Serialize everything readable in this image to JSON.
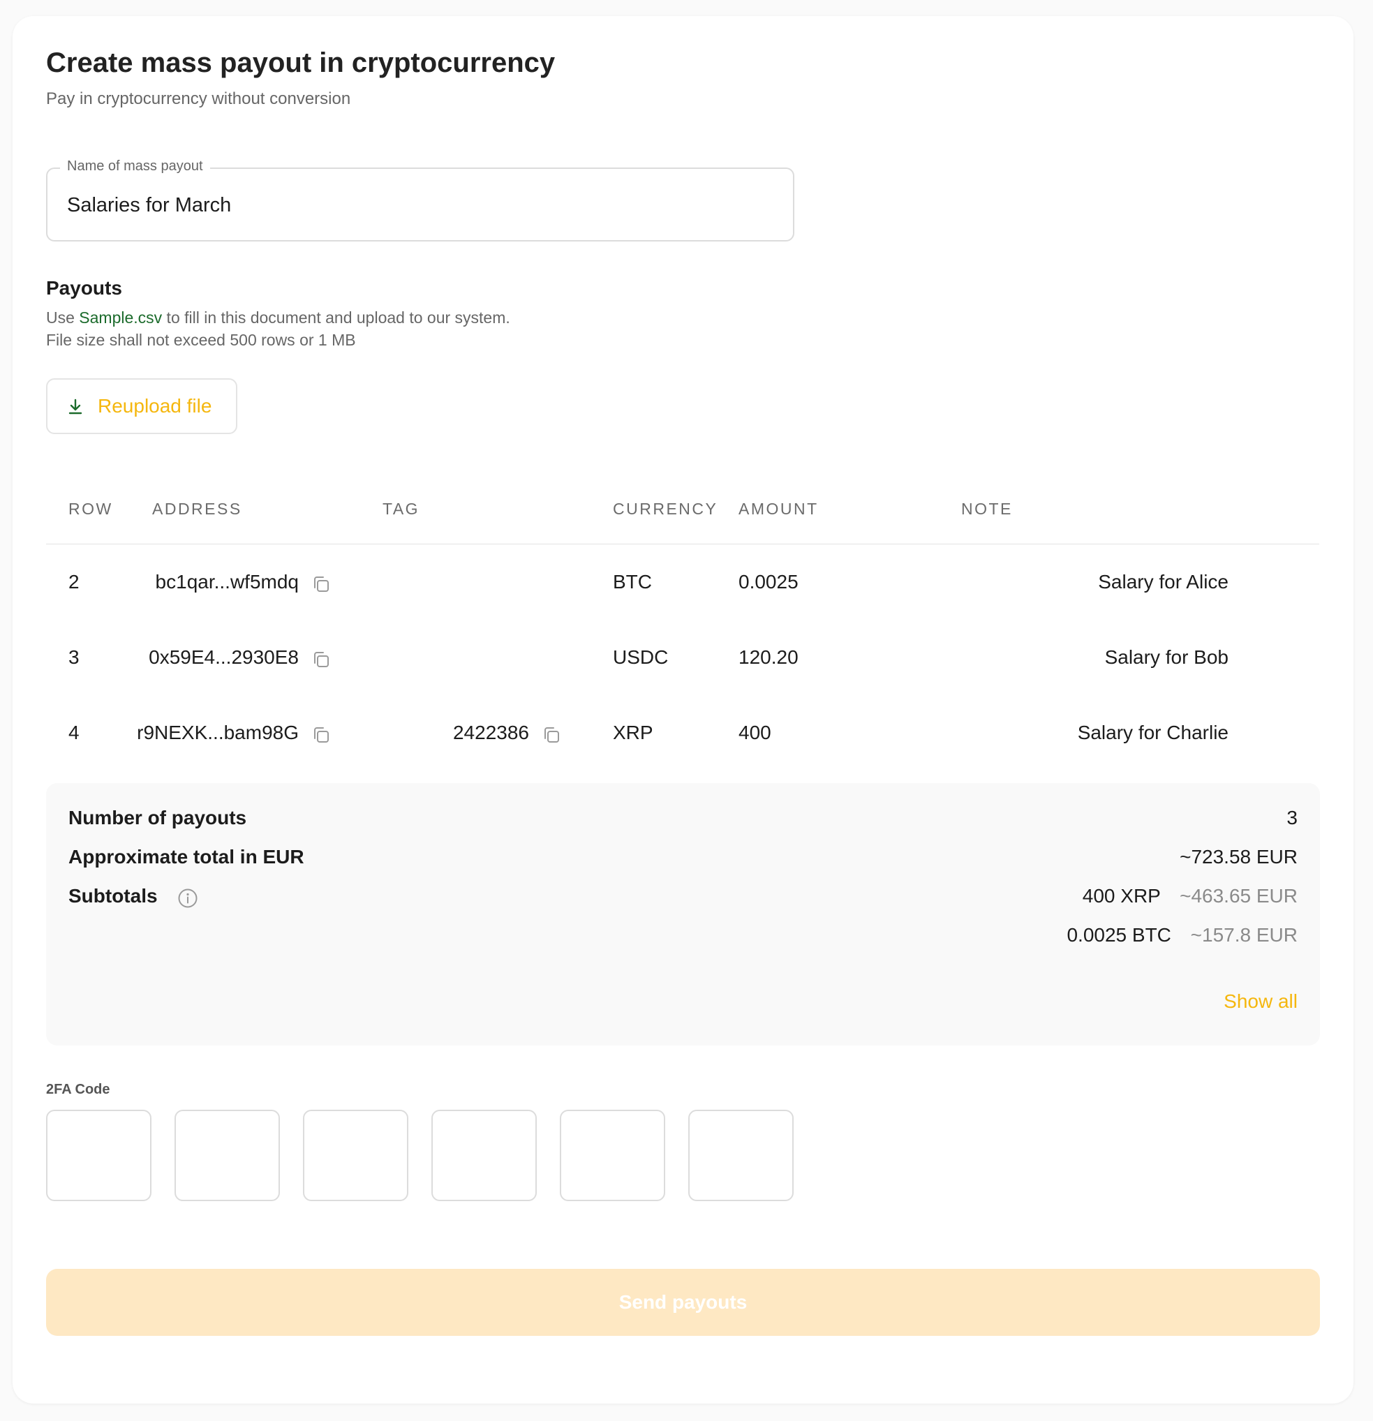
{
  "header": {
    "title": "Create mass payout in cryptocurrency",
    "subtitle": "Pay in cryptocurrency without conversion"
  },
  "name_field": {
    "label": "Name of mass payout",
    "value": "Salaries for March"
  },
  "payouts": {
    "title": "Payouts",
    "hint_prefix": "Use ",
    "hint_link": "Sample.csv",
    "hint_suffix": " to fill in this document and upload to our system.",
    "hint_limit": "File size shall not exceed 500 rows or 1 MB",
    "reupload_label": "Reupload file"
  },
  "table": {
    "headers": {
      "row": "ROW",
      "address": "ADDRESS",
      "tag": "TAG",
      "currency": "CURRENCY",
      "amount": "AMOUNT",
      "note": "NOTE"
    },
    "rows": [
      {
        "row": "2",
        "address": "bc1qar...wf5mdq",
        "tag": "",
        "currency": "BTC",
        "amount": "0.0025",
        "note": "Salary for Alice"
      },
      {
        "row": "3",
        "address": "0x59E4...2930E8",
        "tag": "",
        "currency": "USDC",
        "amount": "120.20",
        "note": "Salary for Bob"
      },
      {
        "row": "4",
        "address": "r9NEXK...bam98G",
        "tag": "2422386",
        "currency": "XRP",
        "amount": "400",
        "note": "Salary for Charlie"
      }
    ]
  },
  "summary": {
    "count_label": "Number of payouts",
    "count_value": "3",
    "total_label": "Approximate total in EUR",
    "total_value": "~723.58 EUR",
    "subtotals_label": "Subtotals",
    "subtotals": [
      {
        "amount": "400 XRP",
        "eur": "~463.65 EUR"
      },
      {
        "amount": "0.0025 BTC",
        "eur": "~157.8 EUR"
      }
    ],
    "show_all": "Show all"
  },
  "tfa": {
    "label": "2FA Code",
    "digits": [
      "",
      "",
      "",
      "",
      "",
      ""
    ]
  },
  "send_label": "Send payouts",
  "colors": {
    "accent": "#f5b70f",
    "link": "#1c6b2c",
    "send_disabled_bg": "#fee8c3"
  }
}
